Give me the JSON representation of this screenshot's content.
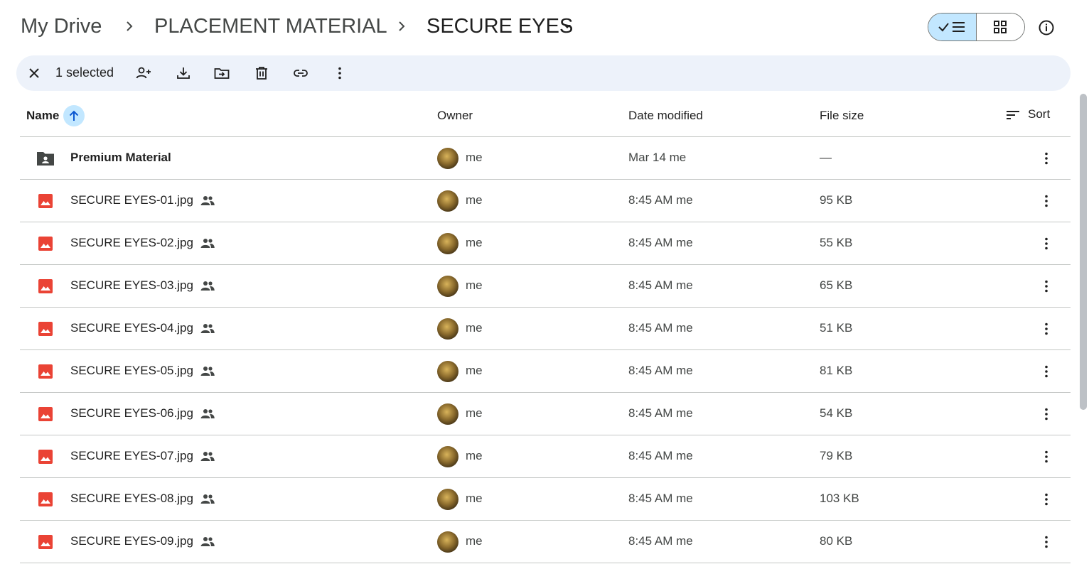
{
  "breadcrumb": {
    "items": [
      "My Drive",
      "PLACEMENT MATERIAL"
    ],
    "current": "SECURE EYES"
  },
  "view_toggle": {
    "list_icon": "check-list-icon",
    "grid_icon": "grid-icon",
    "selected": "list"
  },
  "info_icon": "info-icon",
  "toolbar": {
    "selected_label": "1 selected",
    "actions": [
      "share-icon",
      "download-icon",
      "move-icon",
      "delete-icon",
      "link-icon",
      "more-icon"
    ]
  },
  "columns": {
    "name": "Name",
    "owner": "Owner",
    "date": "Date modified",
    "size": "File size",
    "sort": "Sort"
  },
  "colors": {
    "accent": "#c2e7ff",
    "toolbar_bg": "#edf2fa",
    "image_icon": "#ea4335",
    "folder_icon": "#444746"
  },
  "rows": [
    {
      "type": "folder",
      "name": "Premium Material",
      "shared": false,
      "owner": "me",
      "date": "Mar 14 me",
      "size": "—"
    },
    {
      "type": "image",
      "name": "SECURE EYES-01.jpg",
      "shared": true,
      "owner": "me",
      "date": "8:45 AM me",
      "size": "95 KB"
    },
    {
      "type": "image",
      "name": "SECURE EYES-02.jpg",
      "shared": true,
      "owner": "me",
      "date": "8:45 AM me",
      "size": "55 KB"
    },
    {
      "type": "image",
      "name": "SECURE EYES-03.jpg",
      "shared": true,
      "owner": "me",
      "date": "8:45 AM me",
      "size": "65 KB"
    },
    {
      "type": "image",
      "name": "SECURE EYES-04.jpg",
      "shared": true,
      "owner": "me",
      "date": "8:45 AM me",
      "size": "51 KB"
    },
    {
      "type": "image",
      "name": "SECURE EYES-05.jpg",
      "shared": true,
      "owner": "me",
      "date": "8:45 AM me",
      "size": "81 KB"
    },
    {
      "type": "image",
      "name": "SECURE EYES-06.jpg",
      "shared": true,
      "owner": "me",
      "date": "8:45 AM me",
      "size": "54 KB"
    },
    {
      "type": "image",
      "name": "SECURE EYES-07.jpg",
      "shared": true,
      "owner": "me",
      "date": "8:45 AM me",
      "size": "79 KB"
    },
    {
      "type": "image",
      "name": "SECURE EYES-08.jpg",
      "shared": true,
      "owner": "me",
      "date": "8:45 AM me",
      "size": "103 KB"
    },
    {
      "type": "image",
      "name": "SECURE EYES-09.jpg",
      "shared": true,
      "owner": "me",
      "date": "8:45 AM me",
      "size": "80 KB"
    }
  ]
}
